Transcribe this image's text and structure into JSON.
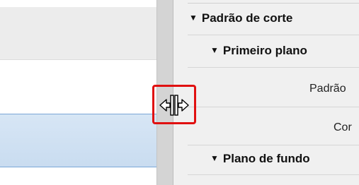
{
  "tree": {
    "section_title": "Padrão de corte",
    "foreground_title": "Primeiro plano",
    "foreground_props": [
      "Padrão",
      "Cor"
    ],
    "background_title": "Plano de fundo"
  },
  "icons": {
    "caret": "▼",
    "cursor": "resize-horizontal-cursor-icon"
  },
  "colors": {
    "highlight": "#e01010",
    "selection": "#d7e6f5",
    "splitter": "#d4d4d4"
  }
}
